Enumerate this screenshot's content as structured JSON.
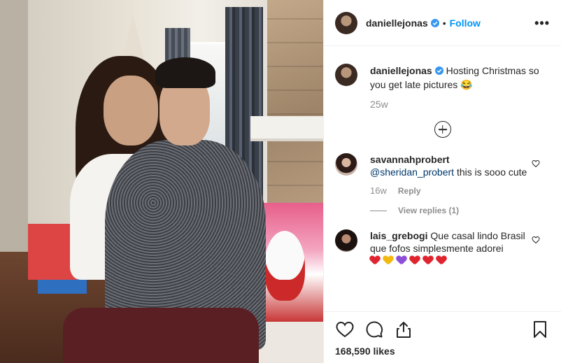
{
  "post": {
    "author": "daniellejonas",
    "verified": true,
    "separator": "•",
    "follow_label": "Follow",
    "more_label": "•••"
  },
  "caption": {
    "username": "daniellejonas",
    "text": "Hosting Christmas so you get late pictures 😂",
    "time": "25w"
  },
  "comments": [
    {
      "username": "savannahprobert",
      "mention": "@sheridan_probert",
      "text": " this is sooo cute",
      "time": "16w",
      "reply_label": "Reply",
      "view_replies": "View replies (1)"
    },
    {
      "username": "lais_grebogi",
      "text": "Que casal lindo Brasil que fofos simplesmente adorei",
      "emoji_hearts": [
        "#e0242f",
        "#f2b90f",
        "#8c4fd8",
        "#e0242f",
        "#e0242f",
        "#e0242f"
      ]
    }
  ],
  "likes": "168,590 likes",
  "colors": {
    "accent": "#0095f6",
    "verified": "#3897f0",
    "muted": "#8e8e8e",
    "text": "#262626"
  },
  "icons": [
    "verified-badge-icon",
    "more-options-icon",
    "load-more-icon",
    "heart-icon",
    "comment-icon",
    "share-icon",
    "bookmark-icon"
  ]
}
